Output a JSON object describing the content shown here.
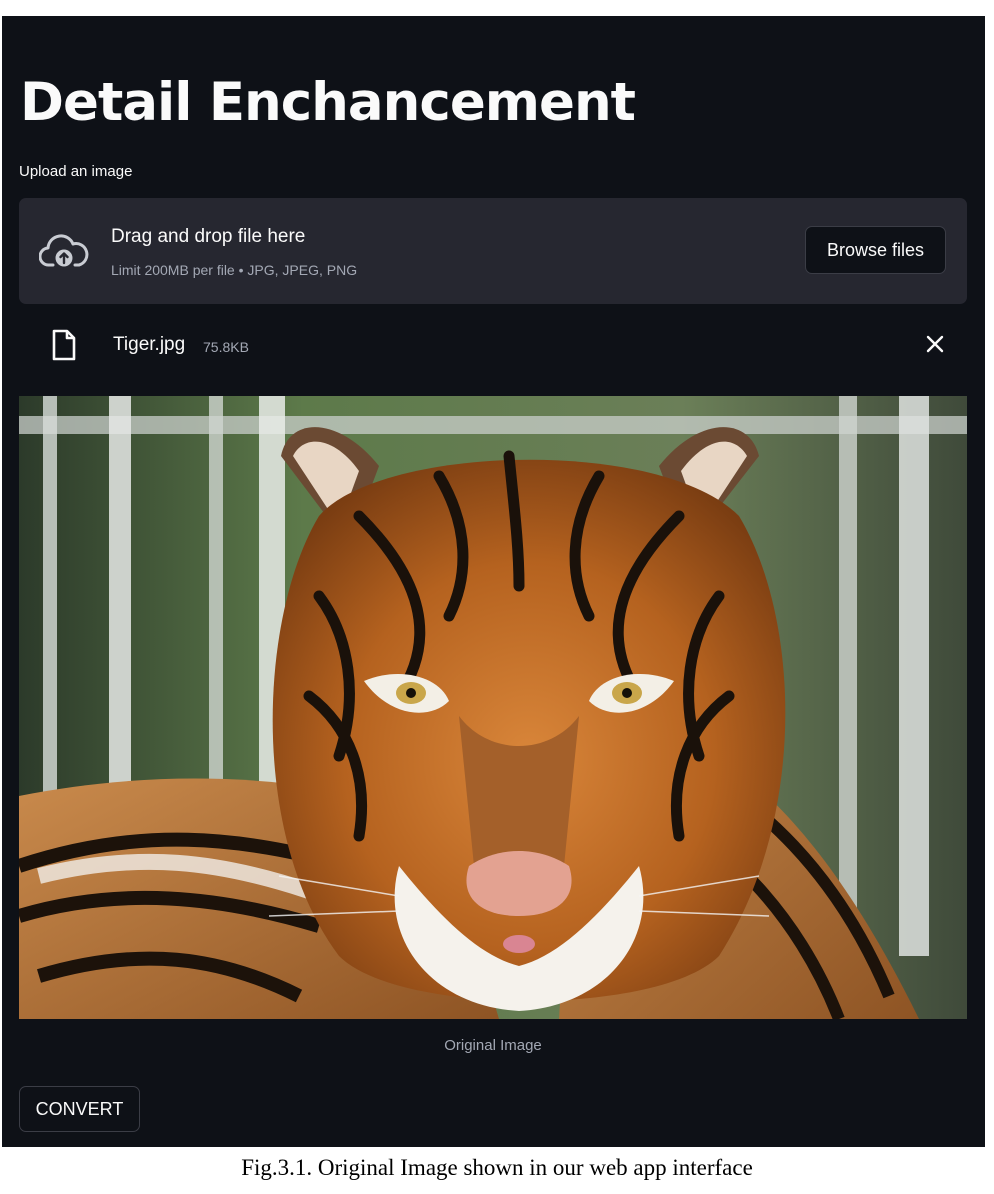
{
  "app": {
    "title": "Detail Enchancement",
    "upload_label": "Upload an image"
  },
  "dropzone": {
    "title": "Drag and drop file here",
    "subtitle": "Limit 200MB per file • JPG, JPEG, PNG",
    "browse_label": "Browse files",
    "icon": "cloud-upload-icon"
  },
  "uploaded_file": {
    "name": "Tiger.jpg",
    "size": "75.8KB",
    "icon": "file-icon",
    "remove_icon": "close-icon"
  },
  "image": {
    "caption": "Original Image",
    "subject": "tiger"
  },
  "actions": {
    "convert_label": "CONVERT"
  },
  "figure": {
    "caption": "Fig.3.1. Original Image shown in our web app interface"
  },
  "colors": {
    "app_background": "#0e1117",
    "dropzone_background": "#262730",
    "text_primary": "#fafafa",
    "text_muted": "#a3a8b4"
  }
}
